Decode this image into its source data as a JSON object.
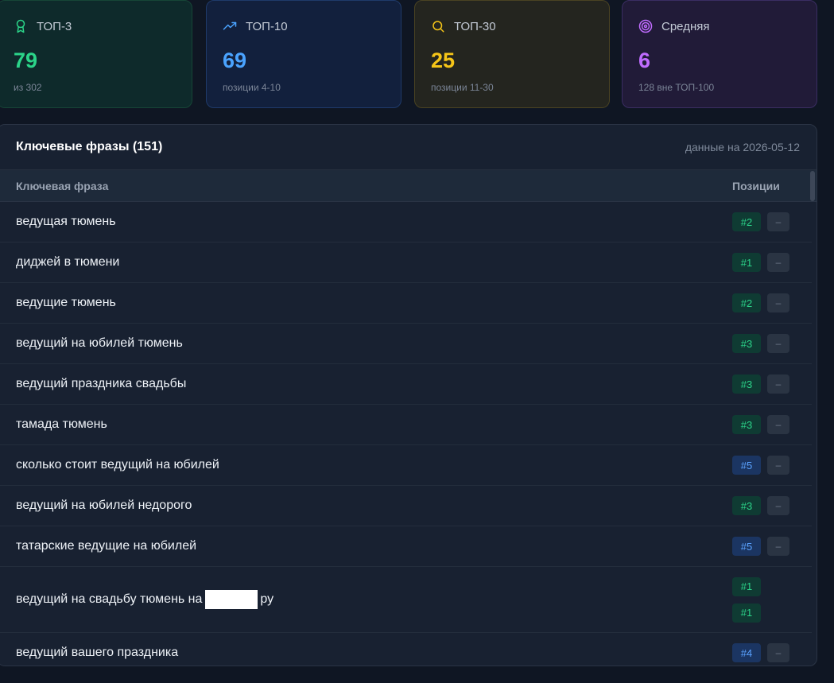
{
  "stats": [
    {
      "label": "ТОП-3",
      "value": "79",
      "sub": "из 302",
      "icon": "award-icon",
      "color": "#2bd489"
    },
    {
      "label": "ТОП-10",
      "value": "69",
      "sub": "позиции 4-10",
      "icon": "trending-up-icon",
      "color": "#4aa3ff"
    },
    {
      "label": "ТОП-30",
      "value": "25",
      "sub": "позиции 11-30",
      "icon": "search-icon",
      "color": "#f5c518"
    },
    {
      "label": "Средняя",
      "value": "6",
      "sub": "128 вне ТОП-100",
      "icon": "target-icon",
      "color": "#c06cff"
    }
  ],
  "panel": {
    "title": "Ключевые фразы (151)",
    "date": "данные на 2026-05-12",
    "col_keyword": "Ключевая фраза",
    "col_positions": "Позиции",
    "dash": "–"
  },
  "rows": [
    {
      "keyword": "ведущая тюмень",
      "positions": [
        "#2"
      ],
      "tone": [
        "green"
      ],
      "dash": true
    },
    {
      "keyword": "диджей в тюмени",
      "positions": [
        "#1"
      ],
      "tone": [
        "green"
      ],
      "dash": true
    },
    {
      "keyword": "ведущие тюмень",
      "positions": [
        "#2"
      ],
      "tone": [
        "green"
      ],
      "dash": true
    },
    {
      "keyword": "ведущий на юбилей тюмень",
      "positions": [
        "#3"
      ],
      "tone": [
        "green"
      ],
      "dash": true
    },
    {
      "keyword": "ведущий праздника свадьбы",
      "positions": [
        "#3"
      ],
      "tone": [
        "green"
      ],
      "dash": true
    },
    {
      "keyword": "тамада тюмень",
      "positions": [
        "#3"
      ],
      "tone": [
        "green"
      ],
      "dash": true
    },
    {
      "keyword": "сколько стоит ведущий на юбилей",
      "positions": [
        "#5"
      ],
      "tone": [
        "blue"
      ],
      "dash": true
    },
    {
      "keyword": "ведущий на юбилей недорого",
      "positions": [
        "#3"
      ],
      "tone": [
        "green"
      ],
      "dash": true
    },
    {
      "keyword": "татарские ведущие на юбилей",
      "positions": [
        "#5"
      ],
      "tone": [
        "blue"
      ],
      "dash": true
    },
    {
      "keyword_before": "ведущий на свадьбу тюмень на",
      "keyword_after": "ру",
      "positions": [
        "#1",
        "#1"
      ],
      "tone": [
        "green",
        "green"
      ],
      "dash": false
    },
    {
      "keyword": "ведущий вашего праздника",
      "positions": [
        "#4"
      ],
      "tone": [
        "blue"
      ],
      "dash": true
    }
  ]
}
